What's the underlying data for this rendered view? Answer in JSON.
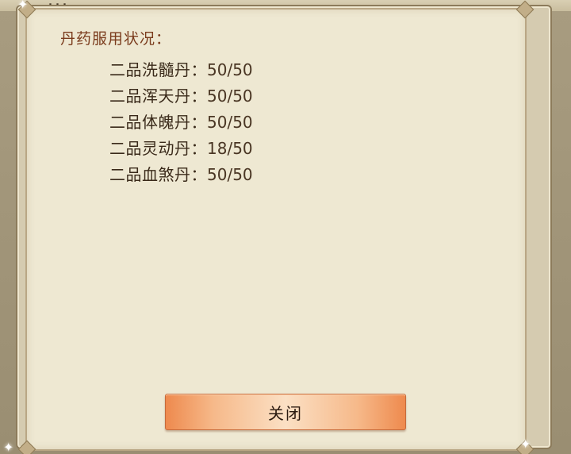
{
  "background": {
    "clipped_title": "..."
  },
  "dialog": {
    "heading": "丹药服用状况：",
    "items": [
      {
        "label": "二品洗髓丹：",
        "value": "50/50"
      },
      {
        "label": "二品浑天丹：",
        "value": "50/50"
      },
      {
        "label": "二品体魄丹：",
        "value": "50/50"
      },
      {
        "label": "二品灵动丹：",
        "value": "18/50"
      },
      {
        "label": "二品血煞丹：",
        "value": "50/50"
      }
    ],
    "close_label": "关闭"
  },
  "colors": {
    "heading": "#7a3b1c",
    "button_edge": "#ee8a4e",
    "button_center": "#fbe0c4",
    "panel_bg": "#eee8d2"
  }
}
